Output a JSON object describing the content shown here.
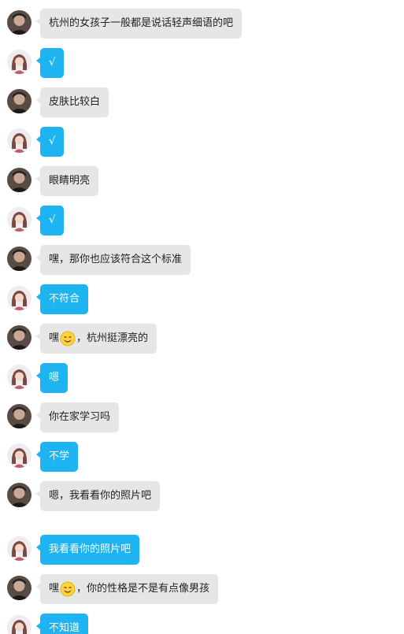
{
  "messages": [
    {
      "sender": "other",
      "text": "杭州的女孩子一般都是说话轻声细语的吧"
    },
    {
      "sender": "me",
      "text": "√"
    },
    {
      "sender": "other",
      "text": "皮肤比较白"
    },
    {
      "sender": "me",
      "text": "√"
    },
    {
      "sender": "other",
      "text": "眼睛明亮"
    },
    {
      "sender": "me",
      "text": "√"
    },
    {
      "sender": "other",
      "text": "嘿，那你也应该符合这个标准"
    },
    {
      "sender": "me",
      "text": "不符合"
    },
    {
      "sender": "other",
      "text_before": "嘿",
      "emoji": "smile-emoji",
      "text_after": "，杭州挺漂亮的"
    },
    {
      "sender": "me",
      "text": "嗯"
    },
    {
      "sender": "other",
      "text": "你在家学习吗"
    },
    {
      "sender": "me",
      "text": "不学"
    },
    {
      "sender": "other",
      "text": "嗯，我看看你的照片吧"
    },
    {
      "sender": "me",
      "text": "我看看你的照片吧"
    },
    {
      "sender": "other",
      "text_before": "嘿",
      "emoji": "smile-emoji",
      "text_after": "，你的性格是不是有点像男孩"
    },
    {
      "sender": "me",
      "text": "不知道"
    }
  ],
  "colors": {
    "other_bubble": "#e6e6e6",
    "me_bubble": "#1eb4f2",
    "other_text": "#222222",
    "me_text": "#ffffff"
  },
  "icons": {
    "other_avatar": "male-avatar-icon",
    "me_avatar": "female-avatar-icon"
  }
}
